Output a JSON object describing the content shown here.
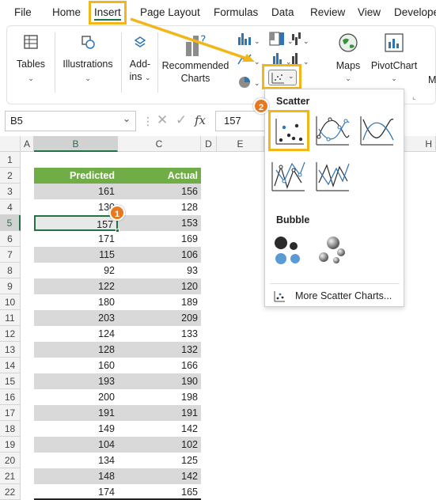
{
  "menu": {
    "tabs": [
      "File",
      "Home",
      "Insert",
      "Page Layout",
      "Formulas",
      "Data",
      "Review",
      "View",
      "Develope"
    ],
    "active": "Insert"
  },
  "ribbon": {
    "tables": "Tables",
    "illustrations": "Illustrations",
    "addins_line1": "Add-",
    "addins_line2": "ins",
    "recommended_line1": "Recommended",
    "recommended_line2": "Charts",
    "maps": "Maps",
    "pivotchart": "PivotChart",
    "cut_off_letter": "M"
  },
  "formula_bar": {
    "name_box": "B5",
    "fx": "fx",
    "value": "157"
  },
  "columns": [
    "A",
    "B",
    "C",
    "D",
    "E",
    "H"
  ],
  "rows": [
    "1",
    "2",
    "3",
    "4",
    "5",
    "6",
    "7",
    "8",
    "9",
    "10",
    "11",
    "12",
    "13",
    "14",
    "15",
    "16",
    "17",
    "18",
    "19",
    "20",
    "21",
    "22"
  ],
  "table": {
    "headers": {
      "predicted": "Predicted",
      "actual": "Actual"
    },
    "header_color": "#70ad47",
    "band_color": "#d9d9d9",
    "predicted": [
      "161",
      "130",
      "157",
      "171",
      "115",
      "92",
      "122",
      "180",
      "203",
      "124",
      "128",
      "160",
      "193",
      "200",
      "191",
      "149",
      "104",
      "134",
      "148",
      "174"
    ],
    "actual": [
      "156",
      "128",
      "153",
      "169",
      "106",
      "93",
      "120",
      "189",
      "209",
      "133",
      "132",
      "166",
      "190",
      "198",
      "191",
      "142",
      "102",
      "125",
      "142",
      "165"
    ]
  },
  "dropdown": {
    "scatter_heading": "Scatter",
    "bubble_heading": "Bubble",
    "more_link": "More Scatter Charts..."
  },
  "callouts": {
    "step1": "1",
    "step2": "2"
  },
  "colors": {
    "highlight": "#f2b619",
    "badge": "#e8781e",
    "arrow": "#f2b619",
    "accent": "#217346"
  }
}
